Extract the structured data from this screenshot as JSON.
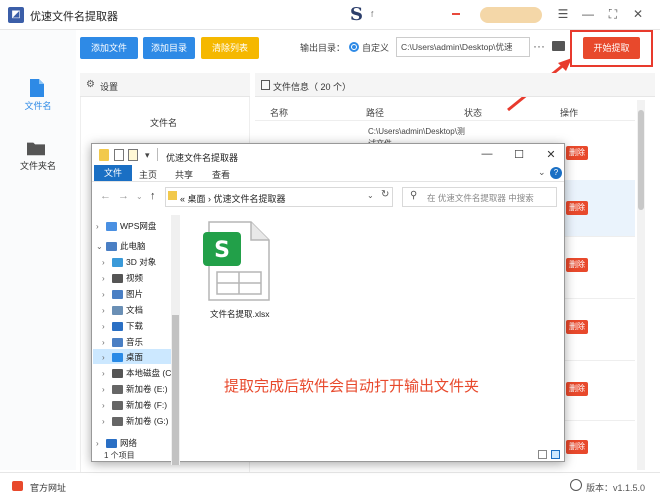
{
  "app": {
    "title": "优速文件名提取器",
    "version_label": "版本：v1.1.5.0",
    "website": "官方网址"
  },
  "nav": {
    "items": [
      {
        "label": "文件名"
      },
      {
        "label": "文件夹名"
      }
    ]
  },
  "toolbar": {
    "add_file": "添加文件",
    "add_dir": "添加目录",
    "clear_list": "清除列表",
    "output_dir_label": "输出目录：",
    "custom_label": "自定义",
    "output_path": "C:\\Users\\admin\\Desktop\\优速",
    "more": "···",
    "start": "开始提取"
  },
  "settings": {
    "title": "设置",
    "filename_label": "文件名"
  },
  "file_info": {
    "title": "文件信息（ 20 个）",
    "columns": {
      "name": "名称",
      "path": "路径",
      "status": "状态",
      "action": "操作"
    },
    "first_path": "C:\\Users\\admin\\Desktop\\测试文件",
    "delete_label": "删除"
  },
  "explorer": {
    "title": "优速文件名提取器",
    "ribbon": {
      "file": "文件",
      "home": "主页",
      "share": "共享",
      "view": "查看"
    },
    "address": "«  桌面  ›  优速文件名提取器",
    "search_placeholder": "在 优速文件名提取器 中搜索",
    "tree": [
      {
        "label": "WPS网盘",
        "indent": 0
      },
      {
        "label": "此电脑",
        "indent": 0
      },
      {
        "label": "3D 对象",
        "indent": 1
      },
      {
        "label": "视频",
        "indent": 1
      },
      {
        "label": "图片",
        "indent": 1
      },
      {
        "label": "文档",
        "indent": 1
      },
      {
        "label": "下载",
        "indent": 1
      },
      {
        "label": "音乐",
        "indent": 1
      },
      {
        "label": "桌面",
        "indent": 1
      },
      {
        "label": "本地磁盘 (C",
        "indent": 1
      },
      {
        "label": "新加卷 (E:)",
        "indent": 1
      },
      {
        "label": "新加卷 (F:)",
        "indent": 1
      },
      {
        "label": "新加卷 (G:)",
        "indent": 1
      },
      {
        "label": "网络",
        "indent": 0
      }
    ],
    "file_name": "文件名提取.xlsx",
    "status": "1 个项目",
    "notice": "提取完成后软件会自动打开输出文件夹"
  }
}
